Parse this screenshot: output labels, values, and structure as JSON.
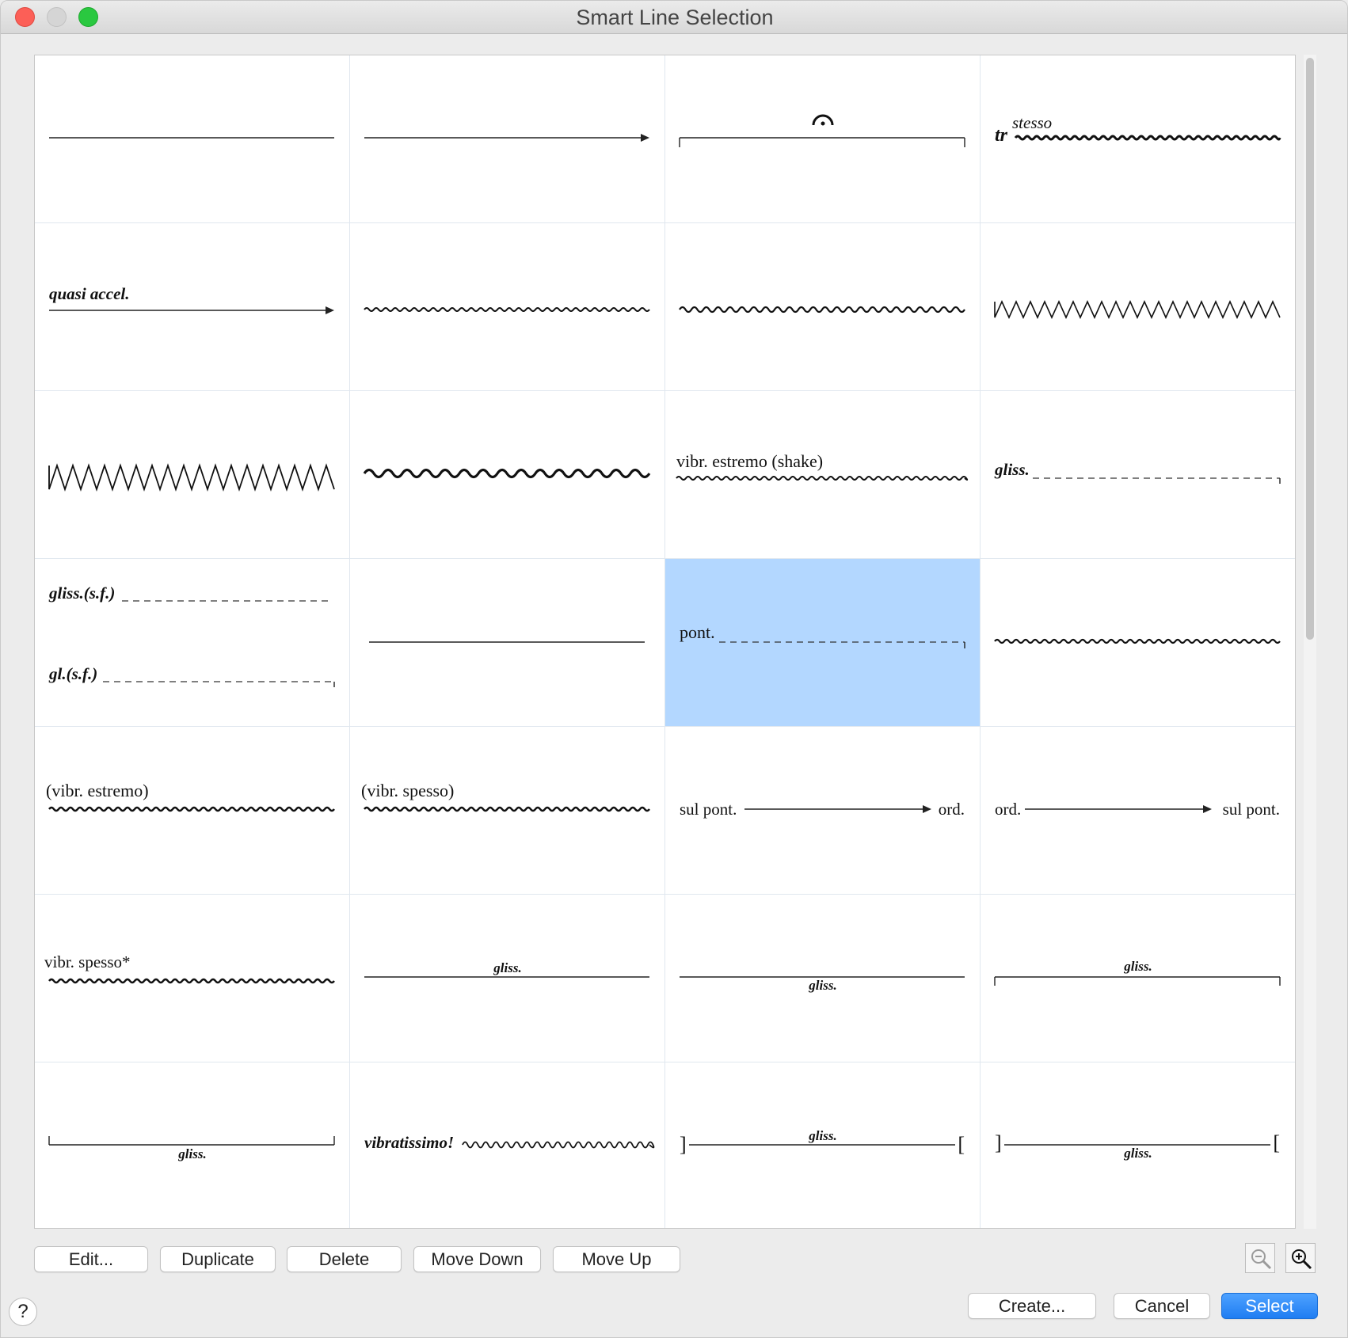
{
  "window": {
    "title": "Smart Line Selection"
  },
  "grid": {
    "columns": 4,
    "selected_index": 14,
    "cells": [
      {
        "kind": "plain-line"
      },
      {
        "kind": "arrow-line"
      },
      {
        "kind": "fermata-bracket-line"
      },
      {
        "kind": "trill-wavy",
        "text": "tr",
        "text2": "stesso"
      },
      {
        "kind": "text-arrow",
        "text": "quasi accel."
      },
      {
        "kind": "small-wavy"
      },
      {
        "kind": "medium-wavy"
      },
      {
        "kind": "tall-zigzag"
      },
      {
        "kind": "tall-zigzag-large"
      },
      {
        "kind": "thick-wavy"
      },
      {
        "kind": "text-wavy",
        "text": "vibr. estremo (shake)"
      },
      {
        "kind": "text-dashed-hook",
        "text": "gliss."
      },
      {
        "kind": "double-dashed",
        "text": "gliss.(s.f.)",
        "text2": "gl.(s.f.)"
      },
      {
        "kind": "plain-line-short"
      },
      {
        "kind": "text-dashed-hook-bold",
        "text": "pont."
      },
      {
        "kind": "small-wavy-mid"
      },
      {
        "kind": "paren-wavy",
        "text": "(vibr. estremo)"
      },
      {
        "kind": "paren-wavy",
        "text": "(vibr. spesso)"
      },
      {
        "kind": "text-arrow-text",
        "text": "sul pont.",
        "text2": "ord."
      },
      {
        "kind": "text-arrow-text",
        "text": "ord.",
        "text2": "sul pont."
      },
      {
        "kind": "text-wavy-bold",
        "text": "vibr. spesso*"
      },
      {
        "kind": "line-text-above",
        "text": "gliss."
      },
      {
        "kind": "line-text-below",
        "text": "gliss."
      },
      {
        "kind": "bracket-down-text-above",
        "text": "gliss."
      },
      {
        "kind": "bracket-up-text-below",
        "text": "gliss."
      },
      {
        "kind": "text-zigzag",
        "text": "vibratissimo!"
      },
      {
        "kind": "brackets-text-above",
        "text": "gliss.",
        "open": "]",
        "close": "["
      },
      {
        "kind": "brackets-text-below",
        "text": "gliss.",
        "open": "]",
        "close": "["
      }
    ]
  },
  "toolbar": {
    "edit": "Edit...",
    "duplicate": "Duplicate",
    "delete": "Delete",
    "move_down": "Move Down",
    "move_up": "Move Up"
  },
  "zoom": {
    "out_icon": "zoom-out-icon",
    "in_icon": "zoom-in-icon"
  },
  "footer": {
    "help": "?",
    "create": "Create...",
    "cancel": "Cancel",
    "select": "Select"
  }
}
